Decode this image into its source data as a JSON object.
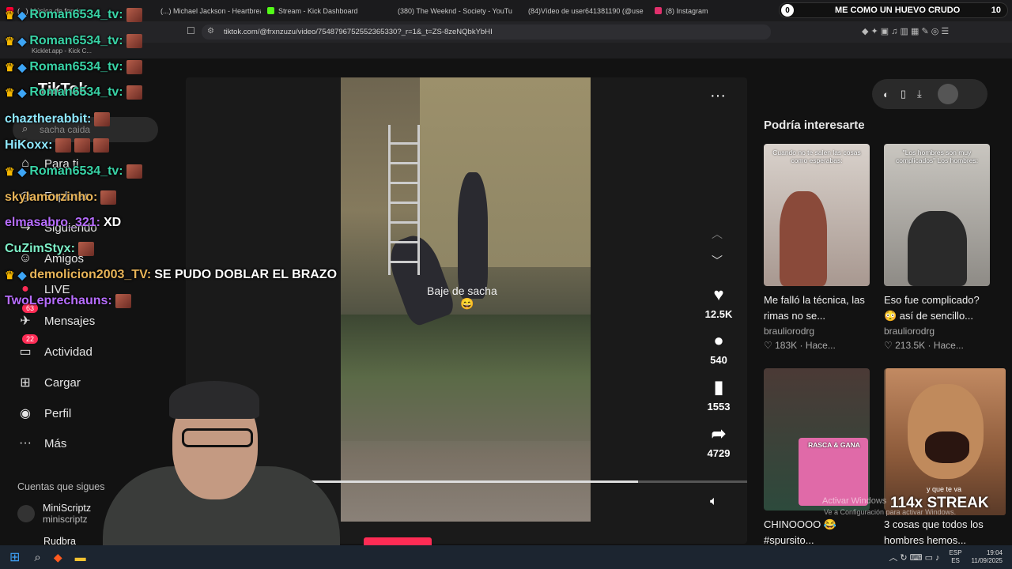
{
  "browser": {
    "tabs": [
      {
        "label": "(...) Música de fondo...",
        "color": "#ff0033"
      },
      {
        "label": "(...) Michael Jackson - Heartbreak",
        "color": "#ff0033"
      },
      {
        "label": "Stream - Kick Dashboard",
        "color": "#53fc18"
      },
      {
        "label": "(380) The Weeknd - Society - YouTu",
        "color": "#ff0033"
      },
      {
        "label": "(84)Vídeo de user641381190 (@use",
        "color": "#ffffff"
      },
      {
        "label": "(8) Instagram",
        "color": "#e1306c"
      }
    ],
    "url": "tiktok.com/@frxnzuzu/video/7548796752552365330?_r=1&_t=ZS-8zeNQbkYbHI",
    "bookmark": "Kicklet.app - Kick C..."
  },
  "top_banner": {
    "left_count": "0",
    "message": "ME COMO UN HUEVO CRUDO",
    "right_count": "10"
  },
  "sidebar": {
    "logo": "TikTok",
    "search_placeholder": "sacha caida",
    "items": [
      {
        "label": "Para ti",
        "icon": "home-icon"
      },
      {
        "label": "Explorar",
        "icon": "compass-icon"
      },
      {
        "label": "Siguiendo",
        "icon": "following-icon"
      },
      {
        "label": "Amigos",
        "icon": "friends-icon"
      },
      {
        "label": "LIVE",
        "icon": "live-icon"
      },
      {
        "label": "Mensajes",
        "icon": "message-icon",
        "badge": "63"
      },
      {
        "label": "Actividad",
        "icon": "activity-icon",
        "badge": "22"
      },
      {
        "label": "Cargar",
        "icon": "upload-icon"
      },
      {
        "label": "Perfil",
        "icon": "profile-icon"
      },
      {
        "label": "Más",
        "icon": "more-icon"
      }
    ],
    "following_title": "Cuentas que sigues",
    "following": [
      {
        "name": "MiniScriptz",
        "handle": "miniscriptz"
      },
      {
        "name": "Rudbra",
        "handle": ""
      }
    ]
  },
  "video": {
    "caption": "Baje de sacha",
    "caption_emoji": "😄",
    "progress": 0.77,
    "actions": [
      {
        "icon": "heart-icon",
        "count": "12.5K"
      },
      {
        "icon": "comment-icon",
        "count": "540"
      },
      {
        "icon": "bookmark-icon",
        "count": "1553"
      },
      {
        "icon": "share-icon",
        "count": "4729"
      }
    ]
  },
  "recommendations": {
    "title": "Podría interesarte",
    "cards": [
      {
        "title": "Me falló la técnica, las rimas no se...",
        "author": "brauliorodrg",
        "views": "183K",
        "time": "Hace...",
        "overlay": "Cuando no te salen las cosas como esperabas:",
        "color": "#b8a9a0"
      },
      {
        "title": "Eso fue complicado? 😳 así de sencillo...",
        "author": "brauliorodrg",
        "views": "213.5K",
        "time": "Hace...",
        "overlay": "\"Los hombres son muy complicados\" Los hombres:",
        "color": "#9c9a94"
      },
      {
        "title": "CHINOOOO 😂 #spursito...",
        "author": "",
        "views": "",
        "time": "",
        "overlay": "RASCA & GANA",
        "color": "#4a3a3a"
      },
      {
        "title": "3 cosas que todos los hombres hemos...",
        "author": "",
        "views": "",
        "time": "",
        "overlay": "y que te va",
        "color": "#7a6a5a"
      }
    ]
  },
  "chat": [
    {
      "user": "Roman6534_tv:",
      "color": "#39d3a6",
      "msg": "",
      "emotes": 1,
      "badges": true
    },
    {
      "user": "Roman6534_tv:",
      "color": "#39d3a6",
      "msg": "",
      "emotes": 1,
      "badges": true
    },
    {
      "user": "Roman6534_tv:",
      "color": "#39d3a6",
      "msg": "",
      "emotes": 1,
      "badges": true
    },
    {
      "user": "Roman6534_tv:",
      "color": "#39d3a6",
      "msg": "",
      "emotes": 1,
      "badges": true
    },
    {
      "user": "chaztherabbit:",
      "color": "#8ee8ff",
      "msg": "",
      "emotes": 1,
      "badges": false
    },
    {
      "user": "HiKoxx:",
      "color": "#8ee8ff",
      "msg": "",
      "emotes": 3,
      "badges": false
    },
    {
      "user": "Roman6534_tv:",
      "color": "#39d3a6",
      "msg": "",
      "emotes": 1,
      "badges": true
    },
    {
      "user": "skylamorzinho:",
      "color": "#e8b458",
      "msg": "",
      "emotes": 1,
      "badges": false
    },
    {
      "user": "elmasabro_321:",
      "color": "#b76dff",
      "msg": "XD",
      "emotes": 0,
      "badges": false
    },
    {
      "user": "CuZimStyx:",
      "color": "#7ef0c8",
      "msg": "",
      "emotes": 1,
      "badges": false
    },
    {
      "user": "demolicion2003_TV:",
      "color": "#e8b458",
      "msg": "SE PUDO DOBLAR EL BRAZO",
      "emotes": 0,
      "badges": true
    },
    {
      "user": "TwoLeprechauns:",
      "color": "#b76dff",
      "msg": "",
      "emotes": 1,
      "badges": false
    }
  ],
  "streak": "114x STREAK",
  "watermark": {
    "line1": "Activar Windows",
    "line2": "Ve a Configuración para activar Windows."
  },
  "taskbar": {
    "lang1": "ESP",
    "lang2": "ES",
    "time": "19:04",
    "date": "11/09/2025"
  }
}
